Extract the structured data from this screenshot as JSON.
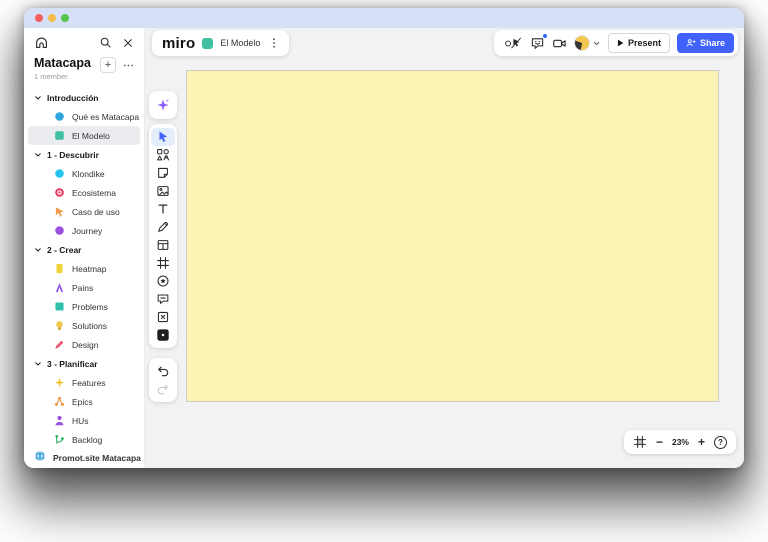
{
  "window": {
    "traffic_lights": [
      {
        "name": "close",
        "color": "#F4605B"
      },
      {
        "name": "minimize",
        "color": "#F6BD4E"
      },
      {
        "name": "zoom",
        "color": "#53C64C"
      }
    ],
    "titlebar_color": "#D6E0F7"
  },
  "sidebar": {
    "workspace": {
      "title": "Matacapa",
      "subtitle": "1 member"
    },
    "header_icons": [
      "home",
      "search",
      "close"
    ],
    "sections": [
      {
        "label": "Introducción",
        "items": [
          {
            "label": "Qué es Matacapa",
            "icon": "circle",
            "color": "#2EA7E0",
            "selected": false
          },
          {
            "label": "El Modelo",
            "icon": "rounded-square",
            "color": "#40BFA3",
            "selected": true
          }
        ]
      },
      {
        "label": "1 - Descubrir",
        "items": [
          {
            "label": "Klondike",
            "icon": "circle",
            "color": "#27C4F0",
            "selected": false
          },
          {
            "label": "Ecosistema",
            "icon": "target",
            "color": "#E8365F",
            "selected": false
          },
          {
            "label": "Caso de uso",
            "icon": "cursor-flag",
            "color": "#F2994A",
            "selected": false
          },
          {
            "label": "Journey",
            "icon": "circle",
            "color": "#9B51E0",
            "selected": false
          }
        ]
      },
      {
        "label": "2 - Crear",
        "items": [
          {
            "label": "Heatmap",
            "icon": "sticky-v",
            "color": "#F2D33C",
            "selected": false
          },
          {
            "label": "Pains",
            "icon": "zigzag",
            "color": "#8F4FE8",
            "selected": false
          },
          {
            "label": "Problems",
            "icon": "sticky",
            "color": "#2EBFAD",
            "selected": false
          },
          {
            "label": "Solutions",
            "icon": "bulb",
            "color": "#F2C94C",
            "selected": false
          },
          {
            "label": "Design",
            "icon": "pen",
            "color": "#EB5777",
            "selected": false
          }
        ]
      },
      {
        "label": "3 - Planificar",
        "items": [
          {
            "label": "Features",
            "icon": "sparkle",
            "color": "#F2C12E",
            "selected": false
          },
          {
            "label": "Epics",
            "icon": "hierarchy",
            "color": "#F2994A",
            "selected": false
          },
          {
            "label": "HUs",
            "icon": "person",
            "color": "#9B51E0",
            "selected": false
          },
          {
            "label": "Backlog",
            "icon": "branch",
            "color": "#27AE60",
            "selected": false
          }
        ]
      }
    ],
    "footer_item": {
      "label": "Promot.site Matacapa",
      "icon": "globe",
      "color": "#2D9CDB"
    }
  },
  "board_header": {
    "logo": "miro",
    "board_name": "El Modelo",
    "board_chip_color": "#40BFA3"
  },
  "collab_bar": {
    "icons": [
      "hidden-cursors",
      "reactions",
      "video-camera",
      "avatar"
    ],
    "reactions_has_notification": true,
    "present_label": "Present",
    "share_label": "Share",
    "share_color": "#4262FF"
  },
  "toolbar": {
    "ai_tool": "ai-assist",
    "tools": [
      {
        "name": "select",
        "active": true
      },
      {
        "name": "templates",
        "active": false
      },
      {
        "name": "sticky-note",
        "active": false
      },
      {
        "name": "image",
        "active": false
      },
      {
        "name": "text",
        "active": false
      },
      {
        "name": "pen",
        "active": false
      },
      {
        "name": "table",
        "active": false
      },
      {
        "name": "frame",
        "active": false
      },
      {
        "name": "sticker",
        "active": false
      },
      {
        "name": "comment",
        "active": false
      },
      {
        "name": "embed",
        "active": false
      },
      {
        "name": "more-tools",
        "active": false
      }
    ],
    "history": [
      "undo",
      "redo"
    ]
  },
  "canvas": {
    "frame_fill": "#FCF3B4",
    "frame_border": "#CDCDC9",
    "background": "#F2F2F3"
  },
  "zoom_controls": {
    "fit": "fit-to-screen",
    "zoom_out": "−",
    "level": "23%",
    "zoom_in": "+",
    "help": "?"
  }
}
